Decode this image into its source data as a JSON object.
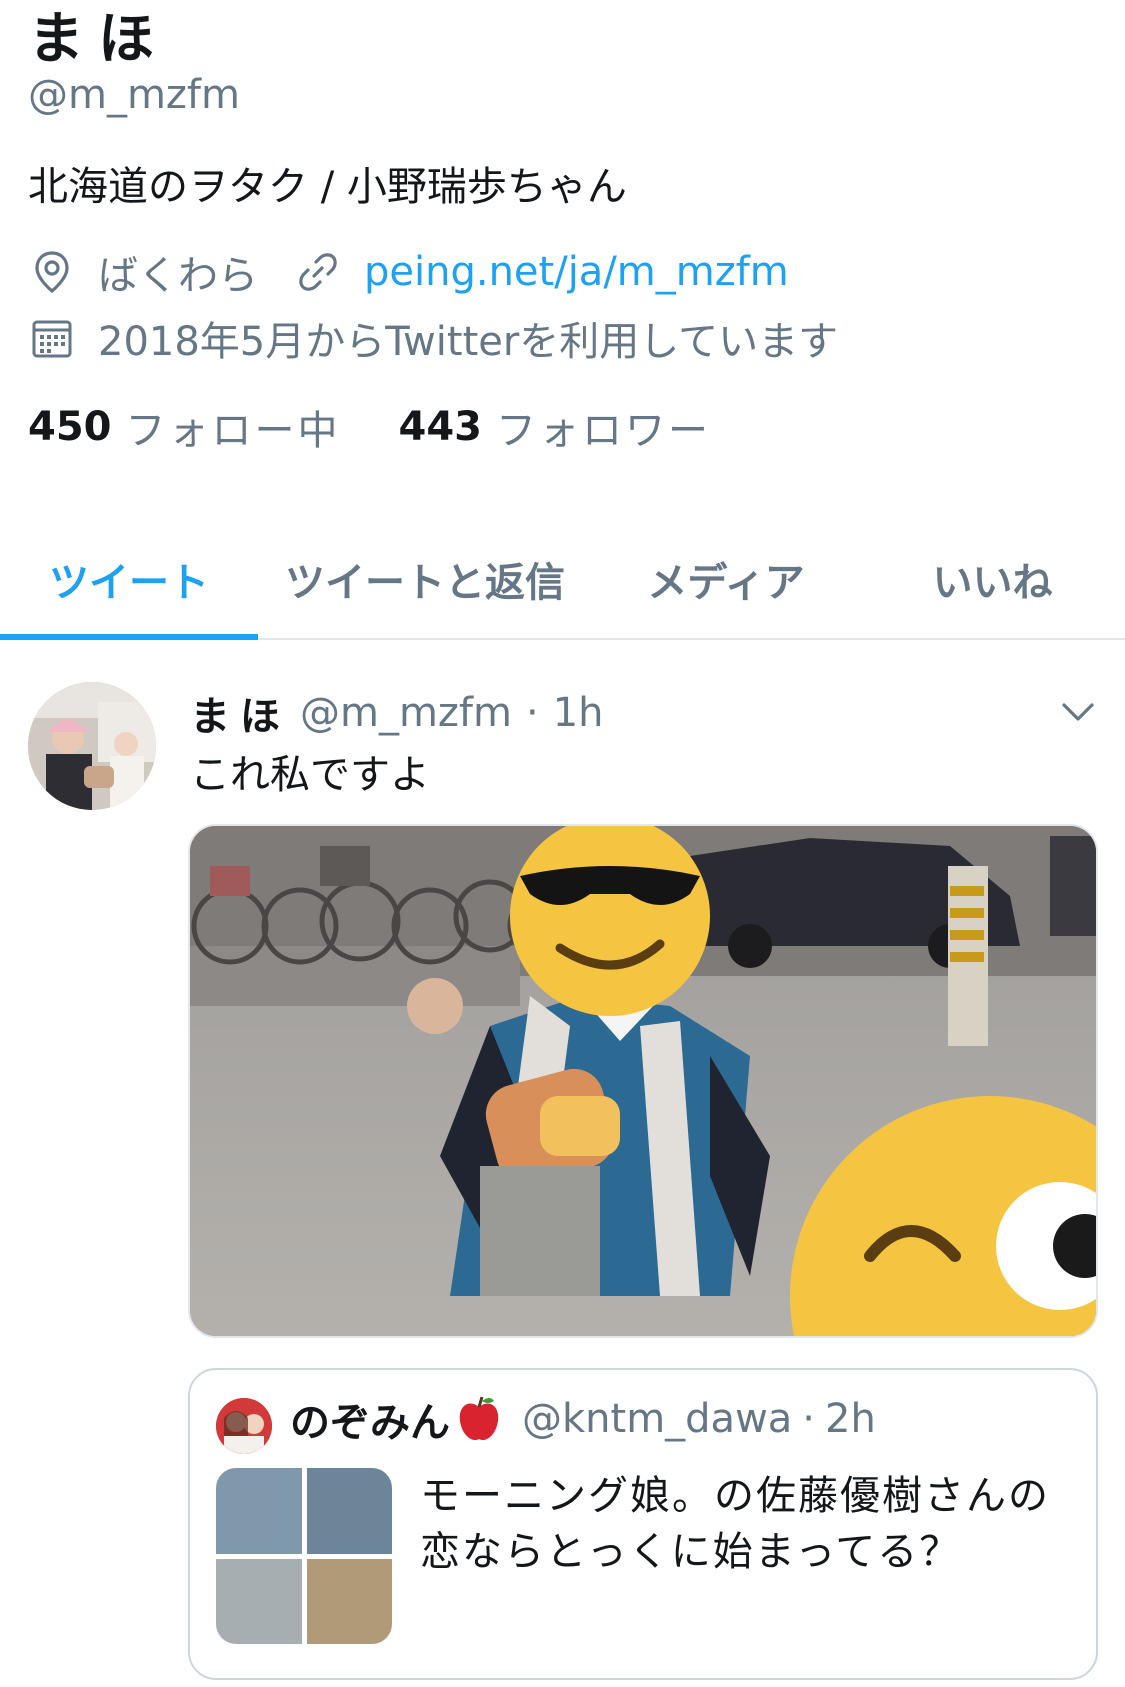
{
  "profile": {
    "display_name": "まほ",
    "handle": "@m_mzfm",
    "bio": "北海道のヲタク / 小野瑞歩ちゃん",
    "location": "ばくわら",
    "link": "peing.net/ja/m_mzfm",
    "joined": "2018年5月からTwitterを利用しています",
    "following_count": "450",
    "following_label": "フォロー中",
    "followers_count": "443",
    "followers_label": "フォロワー",
    "icons": {
      "location": "map-pin-icon",
      "link": "link-icon",
      "joined": "calendar-icon"
    }
  },
  "tabs": [
    {
      "label": "ツイート",
      "active": true
    },
    {
      "label": "ツイートと返信",
      "active": false
    },
    {
      "label": "メディア",
      "active": false
    },
    {
      "label": "いいね",
      "active": false
    }
  ],
  "tweet": {
    "name": "まほ",
    "handle": "@m_mzfm",
    "separator": "·",
    "time": "1h",
    "text": "これ私ですよ",
    "caret_icon": "chevron-down-icon",
    "media_icons": [
      "sunglasses-emoji",
      "winking-emoji"
    ]
  },
  "quote": {
    "name": "のぞみん",
    "emoji": "apple-icon",
    "handle": "@kntm_dawa",
    "separator": "·",
    "time": "2h",
    "text": "モーニング娘。の佐藤優樹さんの恋ならとっくに始まってる？"
  },
  "colors": {
    "accent": "#1da1f2",
    "text": "#14171a",
    "secondary": "#657786",
    "divider": "#e1e8ed"
  }
}
